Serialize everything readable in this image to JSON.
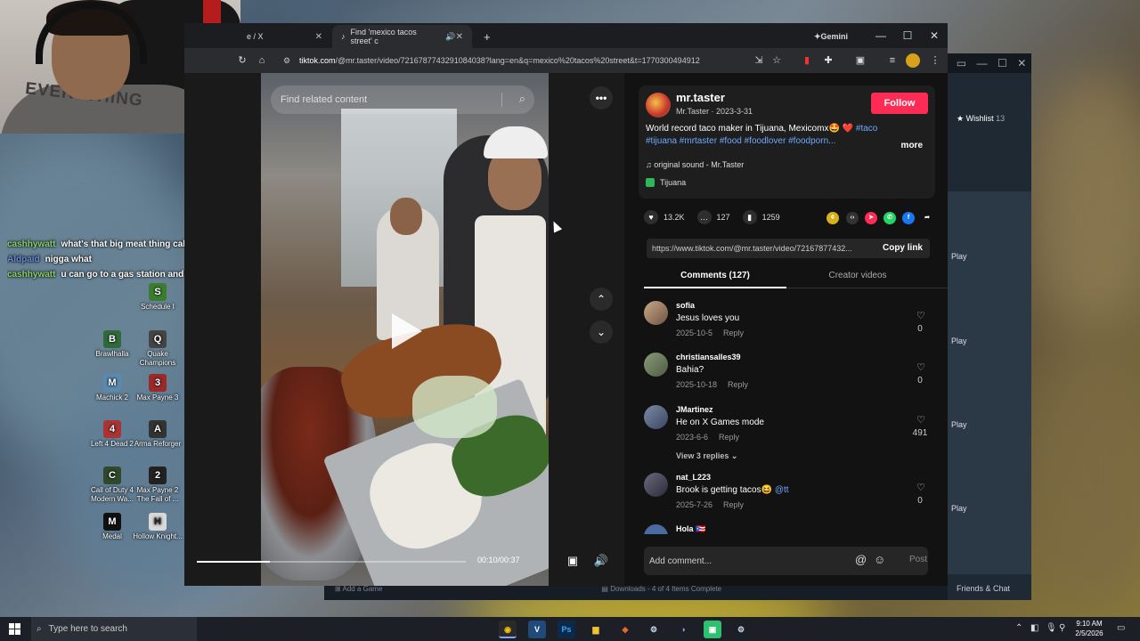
{
  "chat": [
    {
      "user": "cashhywatt",
      "text": "what's that big meat thing called?",
      "color": "green"
    },
    {
      "user": "Aldpaid",
      "text": "nigga what",
      "color": "blue"
    },
    {
      "user": "cashhywatt",
      "text": "u can go to a gas station and get that same p",
      "color": "green"
    }
  ],
  "webcam": {
    "shirt_text": "EVERYTHING"
  },
  "desktop_icons": [
    {
      "label": "Schedule I",
      "glyph": "S"
    },
    {
      "label": "Brawlhalla",
      "glyph": "B"
    },
    {
      "label": "Quake Champions",
      "glyph": "Q"
    },
    {
      "label": "Machick 2",
      "glyph": "M"
    },
    {
      "label": "Max Payne 3",
      "glyph": "3"
    },
    {
      "label": "Left 4 Dead 2",
      "glyph": "4"
    },
    {
      "label": "Arma Reforger",
      "glyph": "A"
    },
    {
      "label": "Call of Duty 4 Modern Wa...",
      "glyph": "C"
    },
    {
      "label": "Max Payne 2 The Fall of ...",
      "glyph": "2"
    },
    {
      "label": "Medal",
      "glyph": "M"
    },
    {
      "label": "Hollow Knight...",
      "glyph": "H"
    }
  ],
  "browser": {
    "tab1_title": "e / X",
    "tab2_title": "Find 'mexico tacos street' c",
    "new_tab": "+",
    "gemini": "Gemini",
    "url_domain": "tiktok.com",
    "url_path": "/@mr.taster/video/7216787743291084038?lang=en&q=mexico%20tacos%20street&t=1770300494912"
  },
  "video": {
    "search_placeholder": "Find related content",
    "time": "00:10/00:37",
    "progress": 0.27
  },
  "post": {
    "username": "mr.taster",
    "display_meta": "Mr.Taster · 2023-3-31",
    "follow_label": "Follow",
    "caption": "World record taco maker in Tijuana, Mexicomx🤩 ❤️",
    "tags_line1": "#taco",
    "tags_line2": "#tijuana #mrtaster #food #foodlover #foodporn...",
    "more": "more",
    "sound": "original sound - Mr.Taster",
    "location": "Tijuana",
    "likes": "13.2K",
    "comments": "127",
    "saves": "1259",
    "link": "https://www.tiktok.com/@mr.taster/video/72167877432...",
    "copy_label": "Copy link",
    "tab_comments": "Comments (127)",
    "tab_creator": "Creator videos"
  },
  "comments": [
    {
      "user": "sofia",
      "text": "Jesus loves you",
      "date": "2025-10-5",
      "reply": "Reply",
      "likes": "0"
    },
    {
      "user": "christiansalles39",
      "text": "Bahia?",
      "date": "2025-10-18",
      "reply": "Reply",
      "likes": "0"
    },
    {
      "user": "JMartinez",
      "text": "He on X Games mode",
      "date": "2023-6-6",
      "reply": "Reply",
      "likes": "491",
      "view_replies": "View 3 replies ⌄"
    },
    {
      "user": "nat_L223",
      "text": "Brook is getting tacos😆",
      "mention": "@tt",
      "date": "2025-7-26",
      "reply": "Reply",
      "likes": "0"
    },
    {
      "user": "Hola 🇵🇷"
    }
  ],
  "add_comment": {
    "placeholder": "Add comment...",
    "post": "Post"
  },
  "steam": {
    "wishlist": "Wishlist",
    "wishlist_count": "13",
    "play": "Play",
    "friends": "Friends & Chat",
    "add_game": "Add a Game",
    "downloads": "Downloads - 4 of 4 Items Complete"
  },
  "taskbar": {
    "search_placeholder": "Type here to search",
    "time": "9:10 AM",
    "date": "2/5/2026"
  }
}
